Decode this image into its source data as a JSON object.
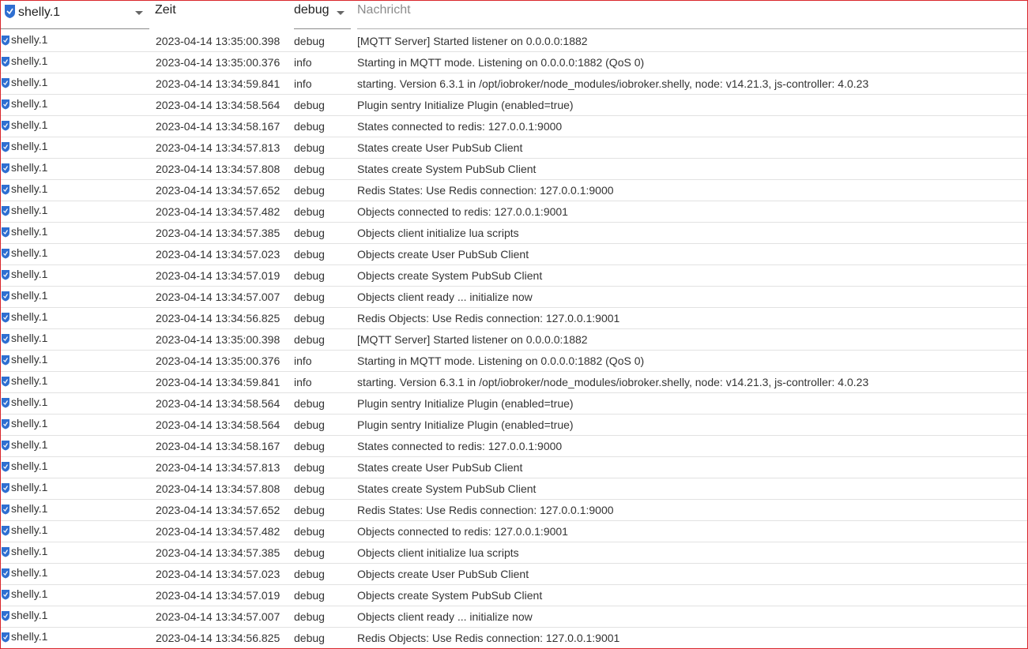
{
  "header": {
    "source_filter": "shelly.1",
    "time_label": "Zeit",
    "level_filter": "debug",
    "message_placeholder": "Nachricht"
  },
  "colors": {
    "frame_border": "#d9262b",
    "icon_blue": "#2f6fd1"
  },
  "icons": {
    "adapter": "shelly-adapter-icon",
    "dropdown": "chevron-down-icon"
  },
  "logs": [
    {
      "source": "shelly.1",
      "time": "2023-04-14 13:35:00.398",
      "level": "debug",
      "message": "[MQTT Server] Started listener on 0.0.0.0:1882"
    },
    {
      "source": "shelly.1",
      "time": "2023-04-14 13:35:00.376",
      "level": "info",
      "message": "Starting in MQTT mode. Listening on 0.0.0.0:1882 (QoS 0)"
    },
    {
      "source": "shelly.1",
      "time": "2023-04-14 13:34:59.841",
      "level": "info",
      "message": "starting. Version 6.3.1 in /opt/iobroker/node_modules/iobroker.shelly, node: v14.21.3, js-controller: 4.0.23"
    },
    {
      "source": "shelly.1",
      "time": "2023-04-14 13:34:58.564",
      "level": "debug",
      "message": "Plugin sentry Initialize Plugin (enabled=true)"
    },
    {
      "source": "shelly.1",
      "time": "2023-04-14 13:34:58.167",
      "level": "debug",
      "message": "States connected to redis: 127.0.0.1:9000"
    },
    {
      "source": "shelly.1",
      "time": "2023-04-14 13:34:57.813",
      "level": "debug",
      "message": "States create User PubSub Client"
    },
    {
      "source": "shelly.1",
      "time": "2023-04-14 13:34:57.808",
      "level": "debug",
      "message": "States create System PubSub Client"
    },
    {
      "source": "shelly.1",
      "time": "2023-04-14 13:34:57.652",
      "level": "debug",
      "message": "Redis States: Use Redis connection: 127.0.0.1:9000"
    },
    {
      "source": "shelly.1",
      "time": "2023-04-14 13:34:57.482",
      "level": "debug",
      "message": "Objects connected to redis: 127.0.0.1:9001"
    },
    {
      "source": "shelly.1",
      "time": "2023-04-14 13:34:57.385",
      "level": "debug",
      "message": "Objects client initialize lua scripts"
    },
    {
      "source": "shelly.1",
      "time": "2023-04-14 13:34:57.023",
      "level": "debug",
      "message": "Objects create User PubSub Client"
    },
    {
      "source": "shelly.1",
      "time": "2023-04-14 13:34:57.019",
      "level": "debug",
      "message": "Objects create System PubSub Client"
    },
    {
      "source": "shelly.1",
      "time": "2023-04-14 13:34:57.007",
      "level": "debug",
      "message": "Objects client ready ... initialize now"
    },
    {
      "source": "shelly.1",
      "time": "2023-04-14 13:34:56.825",
      "level": "debug",
      "message": "Redis Objects: Use Redis connection: 127.0.0.1:9001"
    },
    {
      "source": "shelly.1",
      "time": "2023-04-14 13:35:00.398",
      "level": "debug",
      "message": "[MQTT Server] Started listener on 0.0.0.0:1882"
    },
    {
      "source": "shelly.1",
      "time": "2023-04-14 13:35:00.376",
      "level": "info",
      "message": "Starting in MQTT mode. Listening on 0.0.0.0:1882 (QoS 0)"
    },
    {
      "source": "shelly.1",
      "time": "2023-04-14 13:34:59.841",
      "level": "info",
      "message": "starting. Version 6.3.1 in /opt/iobroker/node_modules/iobroker.shelly, node: v14.21.3, js-controller: 4.0.23"
    },
    {
      "source": "shelly.1",
      "time": "2023-04-14 13:34:58.564",
      "level": "debug",
      "message": "Plugin sentry Initialize Plugin (enabled=true)"
    },
    {
      "source": "shelly.1",
      "time": "2023-04-14 13:34:58.564",
      "level": "debug",
      "message": "Plugin sentry Initialize Plugin (enabled=true)"
    },
    {
      "source": "shelly.1",
      "time": "2023-04-14 13:34:58.167",
      "level": "debug",
      "message": "States connected to redis: 127.0.0.1:9000"
    },
    {
      "source": "shelly.1",
      "time": "2023-04-14 13:34:57.813",
      "level": "debug",
      "message": "States create User PubSub Client"
    },
    {
      "source": "shelly.1",
      "time": "2023-04-14 13:34:57.808",
      "level": "debug",
      "message": "States create System PubSub Client"
    },
    {
      "source": "shelly.1",
      "time": "2023-04-14 13:34:57.652",
      "level": "debug",
      "message": "Redis States: Use Redis connection: 127.0.0.1:9000"
    },
    {
      "source": "shelly.1",
      "time": "2023-04-14 13:34:57.482",
      "level": "debug",
      "message": "Objects connected to redis: 127.0.0.1:9001"
    },
    {
      "source": "shelly.1",
      "time": "2023-04-14 13:34:57.385",
      "level": "debug",
      "message": "Objects client initialize lua scripts"
    },
    {
      "source": "shelly.1",
      "time": "2023-04-14 13:34:57.023",
      "level": "debug",
      "message": "Objects create User PubSub Client"
    },
    {
      "source": "shelly.1",
      "time": "2023-04-14 13:34:57.019",
      "level": "debug",
      "message": "Objects create System PubSub Client"
    },
    {
      "source": "shelly.1",
      "time": "2023-04-14 13:34:57.007",
      "level": "debug",
      "message": "Objects client ready ... initialize now"
    },
    {
      "source": "shelly.1",
      "time": "2023-04-14 13:34:56.825",
      "level": "debug",
      "message": "Redis Objects: Use Redis connection: 127.0.0.1:9001"
    }
  ]
}
